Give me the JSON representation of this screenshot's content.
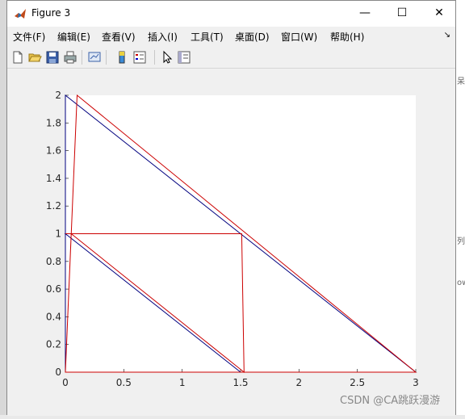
{
  "window": {
    "title": "Figure 3",
    "controls": {
      "minimize": "—",
      "maximize": "☐",
      "close": "✕"
    }
  },
  "menu": {
    "items": [
      "文件(F)",
      "编辑(E)",
      "查看(V)",
      "插入(I)",
      "工具(T)",
      "桌面(D)",
      "窗口(W)",
      "帮助(H)"
    ],
    "dock_arrow": "↘"
  },
  "toolbar": {
    "icons": [
      "new-figure-icon",
      "open-file-icon",
      "save-icon",
      "print-icon",
      "link-plot-icon",
      "insert-colorbar-icon",
      "insert-legend-icon",
      "edit-plot-icon",
      "property-inspector-icon"
    ]
  },
  "background": {
    "right_fragments": [
      "呆",
      "列",
      "ow"
    ]
  },
  "watermark": "CSDN @CA跳跃漫游",
  "chart_data": {
    "type": "line",
    "title": "",
    "xlabel": "",
    "ylabel": "",
    "xlim": [
      0,
      3
    ],
    "ylim": [
      0,
      2
    ],
    "xticks": [
      "0",
      "0.5",
      "1",
      "1.5",
      "2",
      "2.5",
      "3"
    ],
    "yticks": [
      "0",
      "0.2",
      "0.4",
      "0.6",
      "0.8",
      "1",
      "1.2",
      "1.4",
      "1.6",
      "1.8",
      "2"
    ],
    "series": [
      {
        "color": "#00007f",
        "x": [
          0,
          0,
          3,
          0,
          0,
          1.5,
          0,
          0.8
        ],
        "y": [
          0,
          2,
          0,
          0,
          1,
          0,
          1,
          1
        ]
      },
      {
        "color": "#cc0000",
        "x": [
          0,
          0.1,
          3,
          0,
          0.05,
          1.53,
          1.51,
          1.45,
          0.05,
          0
        ],
        "y": [
          0,
          2,
          0,
          0,
          1,
          0,
          1,
          1,
          1,
          1
        ]
      }
    ]
  }
}
